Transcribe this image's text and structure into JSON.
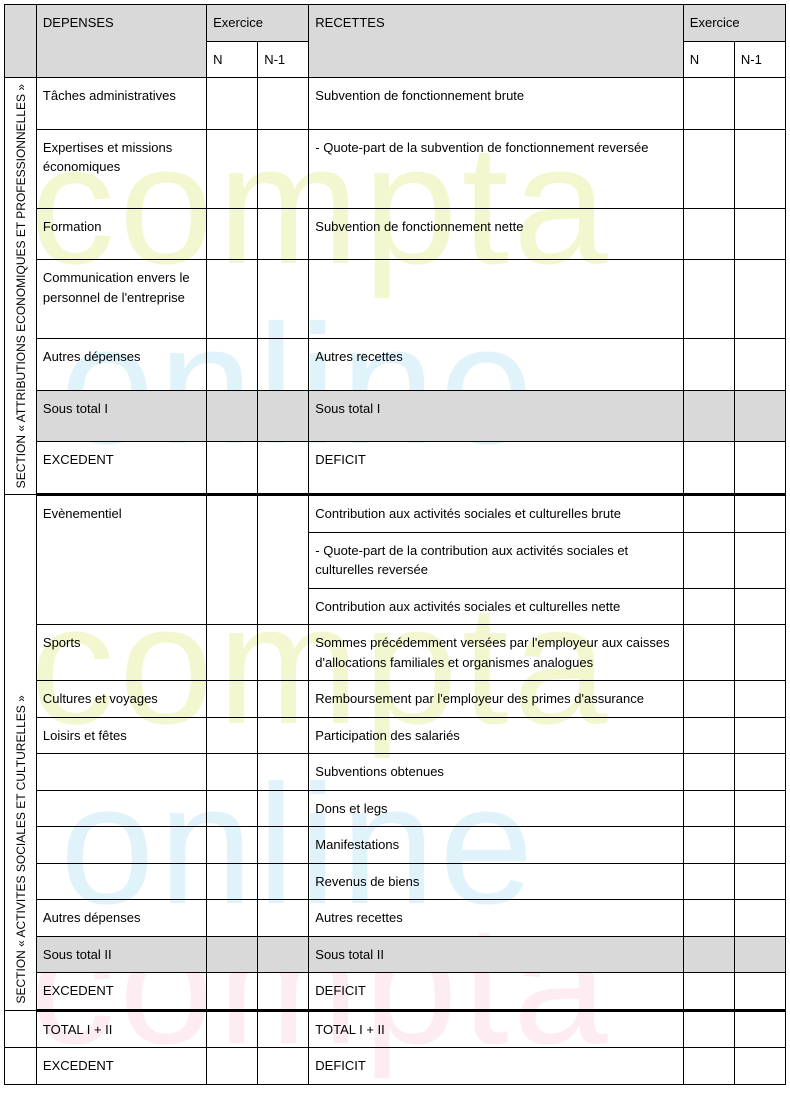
{
  "headers": {
    "depenses": "DEPENSES",
    "exercice": "Exercice",
    "recettes": "RECETTES",
    "n": "N",
    "n1": "N-1"
  },
  "section1": {
    "title": "SECTION « ATTRIBUTIONS ECONOMIQUES ET PROFESSIONNELLES »",
    "rows": {
      "r1d": "Tâches administratives",
      "r1r": "Subvention de fonctionnement brute",
      "r2d": "Expertises et missions économiques",
      "r2r": "- Quote-part de la subvention de fonctionnement reversée",
      "r3d": "Formation",
      "r3r": "Subvention de fonctionnement nette",
      "r4d": "Communication envers le personnel de l'entreprise",
      "r4r": "",
      "r5d": "Autres dépenses",
      "r5r": "Autres recettes",
      "st_d": "Sous total I",
      "st_r": "Sous total I",
      "ex_d": "EXCEDENT",
      "ex_r": "DEFICIT"
    }
  },
  "section2": {
    "title": "SECTION « ACTIVITES SOCIALES ET CULTURELLES »",
    "rows": {
      "r1d": "Evènementiel",
      "r1r_a": "Contribution aux activités sociales et culturelles brute",
      "r1r_b": "- Quote-part de la contribution aux activités sociales et culturelles reversée",
      "r1r_c": "Contribution aux activités sociales et culturelles nette",
      "r2d": "Sports",
      "r2r": "Sommes précédemment versées par l'employeur aux caisses d'allocations familiales et organismes analogues",
      "r3d": "Cultures et voyages",
      "r3r": "Remboursement par l'employeur des primes d'assurance",
      "r4d": "Loisirs et fêtes",
      "r4r": "Participation des salariés",
      "r5r": "Subventions obtenues",
      "r6r": "Dons et legs",
      "r7r": "Manifestations",
      "r8r": "Revenus de biens",
      "r9d": "Autres dépenses",
      "r9r": "Autres recettes",
      "st_d": "Sous total II",
      "st_r": "Sous total II",
      "ex_d": "EXCEDENT",
      "ex_r": "DEFICIT"
    }
  },
  "totals": {
    "t1_d": "TOTAL I + II",
    "t1_r": "TOTAL I + II",
    "t2_d": "EXCEDENT",
    "t2_r": "DEFICIT"
  }
}
